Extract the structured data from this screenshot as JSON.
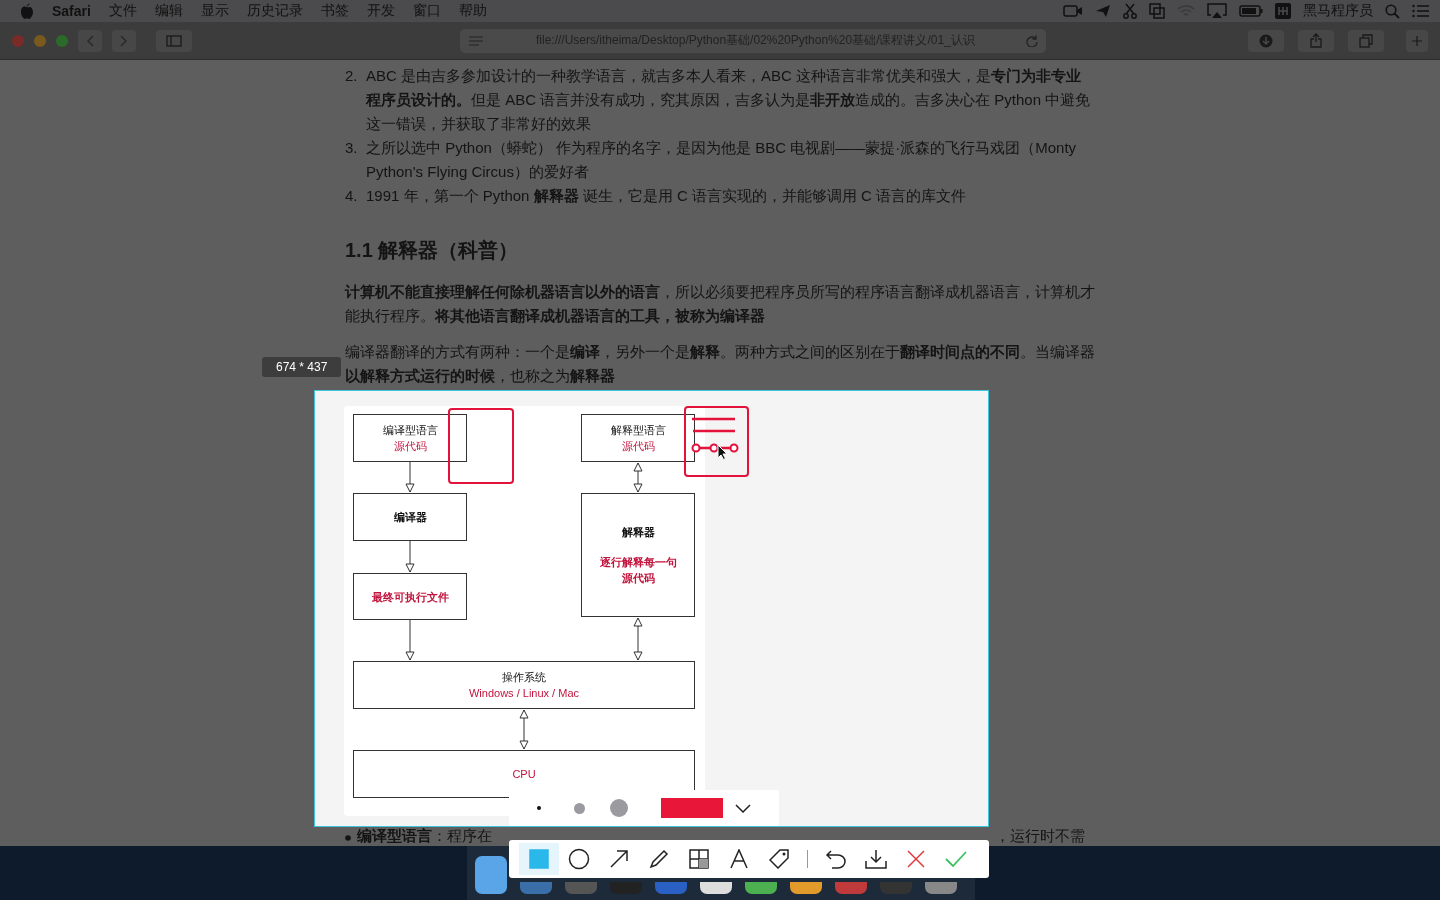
{
  "menu_bar": {
    "app_name": "Safari",
    "menus": [
      "文件",
      "编辑",
      "显示",
      "历史记录",
      "书签",
      "开发",
      "窗口",
      "帮助"
    ],
    "user": "黑马程序员"
  },
  "browser": {
    "url": "file:///Users/itheima/Desktop/Python基础/02%20Python%20基础/课程讲义/01_认识"
  },
  "document": {
    "list_items": [
      {
        "number": "2.",
        "text": "ABC 是由吉多参加设计的一种教学语言，就吉多本人看来，ABC 这种语言非常优美和强大，是**专门为非专业程序员设计的。**但是 ABC 语言并没有成功，究其原因，吉多认为是**非开放**造成的。吉多决心在 Python 中避免这一错误，并获取了非常好的效果"
      },
      {
        "number": "3.",
        "text": "之所以选中 Python（蟒蛇） 作为程序的名字，是因为他是 BBC 电视剧——蒙提·派森的飞行马戏团（Monty Python's Flying Circus）的爱好者"
      },
      {
        "number": "4.",
        "text": "1991 年，第一个 Python **解释器** 诞生，它是用 C 语言实现的，并能够调用 C 语言的库文件"
      }
    ],
    "heading": "1.1 解释器（科普）",
    "paragraphs": [
      "**计算机不能直接理解任何除机器语言以外的语言**，所以必须要把程序员所写的程序语言翻译成机器语言，计算机才能执行程序。**将其他语言翻译成机器语言的工具，被称为编译器**",
      "编译器翻译的方式有两种：一个是**编译**，另外一个是**解释**。两种方式之间的区别在于**翻译时间点的不同**。当编译器**以解释方式运行的时候**，也称之为**解释器**"
    ],
    "bullet": {
      "term": "编译型语言",
      "text_start": "：程序在",
      "text_end": "，运行时不需"
    }
  },
  "capture": {
    "size_label": "674 * 437",
    "diagram": {
      "boxes": [
        {
          "title": "编译型语言",
          "subtitle": "源代码",
          "bold": false
        },
        {
          "title": "编译器",
          "bold": true
        },
        {
          "subtitle": "最终可执行文件",
          "bold": true
        },
        {
          "title": "解释型语言",
          "subtitle": "源代码",
          "bold": false
        },
        {
          "title": "解释器",
          "subtitle": "逐行解释每一句",
          "subtitle_2": "源代码",
          "bold": true
        },
        {
          "title": "操作系统",
          "subtitle": "Windows / Linux / Mac",
          "bold": false
        },
        {
          "subtitle": "CPU",
          "bold": false
        }
      ]
    },
    "options": {
      "sizes": [
        {
          "selected": true
        },
        {
          "selected": false
        },
        {
          "selected": false
        }
      ],
      "color": "#e8173a"
    },
    "tools": [
      {
        "kind": "rectangle",
        "selected": true
      },
      {
        "kind": "ellipse",
        "selected": false
      },
      {
        "kind": "arrow",
        "selected": false
      },
      {
        "kind": "pen",
        "selected": false
      },
      {
        "kind": "mosaic",
        "selected": false
      },
      {
        "kind": "text",
        "selected": false
      },
      {
        "kind": "tag",
        "selected": false
      },
      {
        "kind": "undo",
        "selected": false
      },
      {
        "kind": "download",
        "selected": false
      },
      {
        "kind": "cancel",
        "selected": false
      },
      {
        "kind": "confirm",
        "selected": false
      }
    ]
  }
}
